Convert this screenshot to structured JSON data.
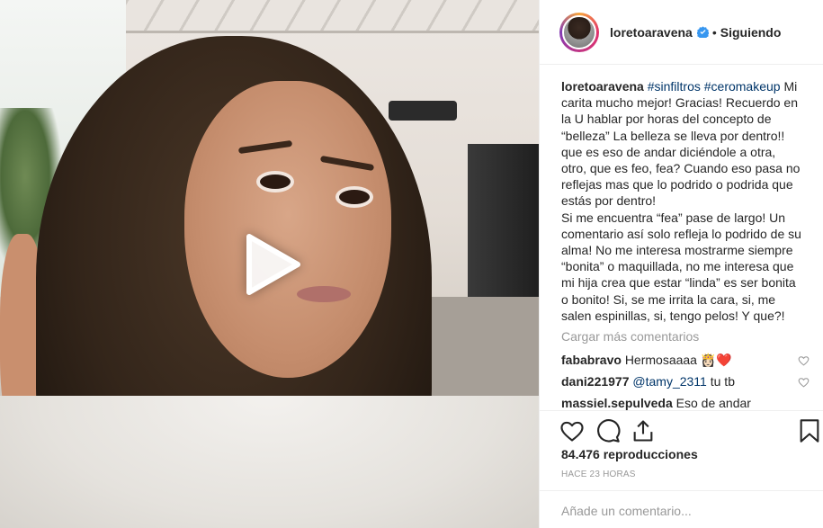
{
  "media": {
    "play_icon": "play-icon"
  },
  "post": {
    "username": "loretoaravena",
    "follow_dot": "•",
    "follow_status": "Siguiendo",
    "verified_icon": "verified-badge-icon",
    "caption_user": "loretoaravena",
    "caption_tags": [
      "#sinfiltros",
      "#ceromakeup"
    ],
    "caption_text": " Mi carita mucho mejor! Gracias! Recuerdo en la U hablar por horas del concepto de “belleza” La belleza se lleva por dentro!! que es eso de andar diciéndole a otra, otro, que es feo, fea? Cuando eso pasa no reflejas mas que lo podrido o podrida que estás por dentro!\nSi me encuentra “fea” pase de largo! Un comentario así solo refleja lo podrido de su alma! No me interesa mostrarme siempre “bonita” o maquillada, no me interesa que mi hija crea que estar “linda” es ser bonita o bonito! Si, se me irrita la cara, si, me salen espinillas, si, tengo pelos! Y que?!",
    "load_more": "Cargar más comentarios",
    "comments": [
      {
        "user": "fababravo",
        "text": "Hermosaaaa 👸🏻❤️",
        "mention": ""
      },
      {
        "user": "dani221977",
        "mention": "@tamy_2311",
        "text": " tu tb"
      },
      {
        "user": "massiel.sepulveda",
        "text": "Eso de andar",
        "mention": ""
      }
    ],
    "views": "84.476 reproducciones",
    "time_ago": "HACE 23 HORAS",
    "comment_placeholder": "Añade un comentario..."
  },
  "icons": {
    "like": "heart-icon",
    "comment": "comment-icon",
    "share": "share-icon",
    "save": "bookmark-icon"
  }
}
